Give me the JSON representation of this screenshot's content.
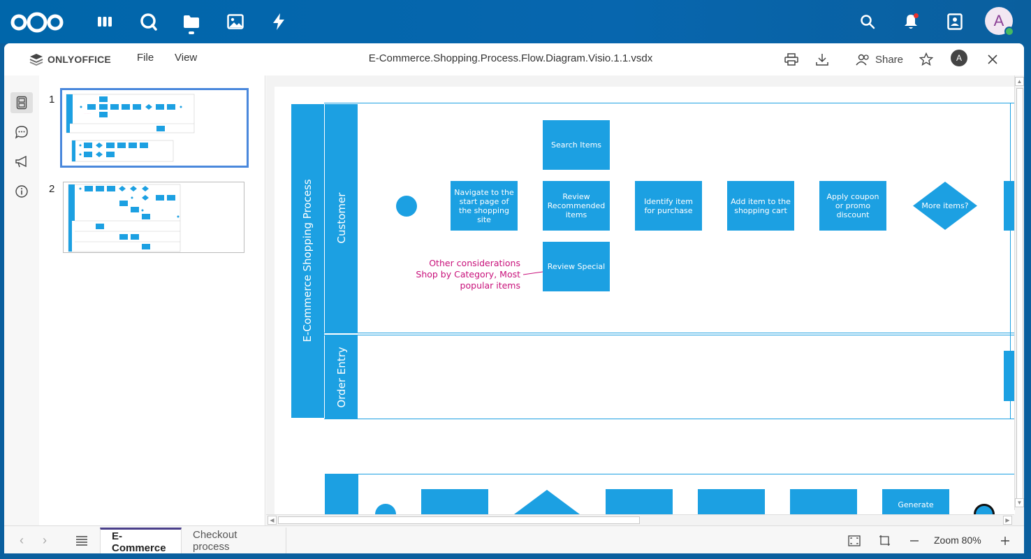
{
  "nextcloud": {
    "apps": [
      "dashboard-icon",
      "talk-icon",
      "files-icon",
      "photos-icon",
      "activity-icon"
    ],
    "user_initial": "A"
  },
  "editor": {
    "brand": "ONLYOFFICE",
    "menu": {
      "file": "File",
      "view": "View"
    },
    "title": "E-Commerce.Shopping.Process.Flow.Diagram.Visio.1.1.vsdx",
    "share_label": "Share",
    "user_initial": "A"
  },
  "thumbnails": [
    {
      "number": "1",
      "active": true
    },
    {
      "number": "2",
      "active": false
    }
  ],
  "diagram": {
    "pool_label": "E-Commerce Shopping Process",
    "lanes": {
      "customer": "Customer",
      "order_entry": "Order Entry"
    },
    "shapes": {
      "search_items": "Search Items",
      "navigate": "Navigate to the start page of the shopping site",
      "review_recommended": "Review Recommended items",
      "identify": "Identify item for purchase",
      "add_cart": "Add item to the shopping cart",
      "coupon": "Apply coupon or promo discount",
      "more_items": "More items?",
      "review_special": "Review Special",
      "generate": "Generate"
    },
    "annotation": {
      "line1": "Other considerations",
      "line2": "Shop by Category, Most",
      "line3": "popular items"
    },
    "colors": {
      "shape": "#1ca0e2",
      "annotation": "#c8107a"
    }
  },
  "bottom_bar": {
    "tabs": [
      "E-Commerce",
      "Checkout process"
    ],
    "active_tab": "E-Commerce",
    "zoom": "Zoom 80%"
  }
}
